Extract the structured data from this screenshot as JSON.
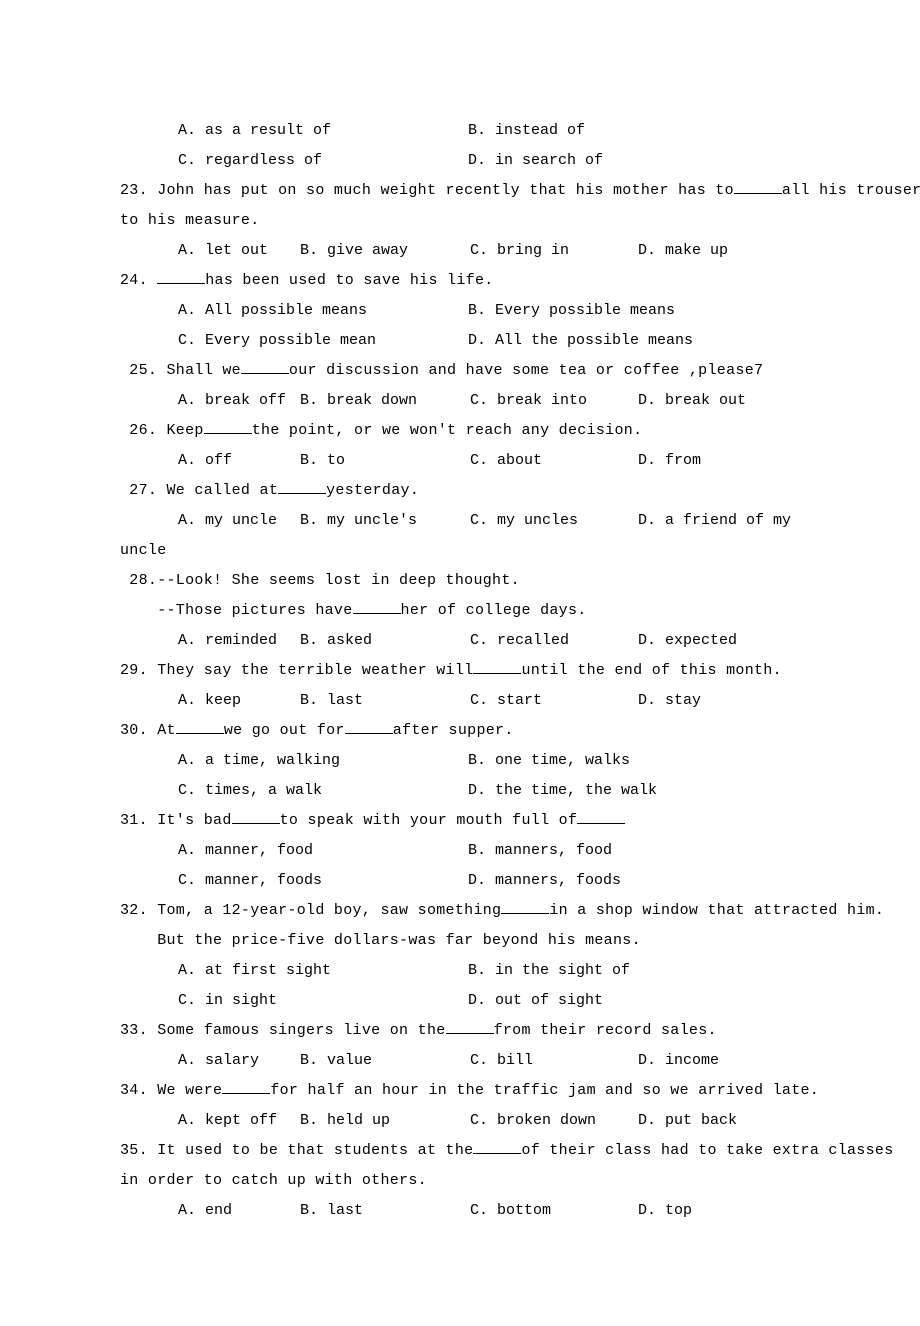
{
  "q22opts1": {
    "a": "A. as a result of",
    "b": "B. instead of"
  },
  "q22opts2": {
    "c": "C. regardless of",
    "d": "D. in search of"
  },
  "q23": {
    "stem_a": "23. John has put on so much weight recently that his mother has to",
    "stem_b": "all his trousers",
    "stem_c": "to his measure.",
    "a": "A. let out",
    "b": "B. give away",
    "c": "C. bring in",
    "d": "D. make up"
  },
  "q24": {
    "stem_a": "24. ",
    "stem_b": "has been used to save his life.",
    "a": "A. All possible means",
    "b": "B. Every possible means",
    "c": "C. Every possible mean",
    "d": "D. All the possible means"
  },
  "q25": {
    "stem_a": " 25. Shall we",
    "stem_b": "our discussion and have some tea or coffee ,please7",
    "a": "A. break off",
    "b": "B. break down",
    "c": "C. break into",
    "d": "D. break out"
  },
  "q26": {
    "stem_a": " 26. Keep",
    "stem_b": "the point, or we won't reach any decision.",
    "a": "A. off",
    "b": "B. to",
    "c": "C. about",
    "d": "D. from"
  },
  "q27": {
    "stem_a": " 27. We called at",
    "stem_b": "yesterday.",
    "a": "A. my uncle",
    "b": "B. my uncle's",
    "c": "C. my uncles",
    "d": "D.  a friend of my",
    "tail": "uncle"
  },
  "q28": {
    "stem1": " 28.--Look! She seems lost in deep thought.",
    "stem2a": "    --Those pictures have",
    "stem2b": "her of college days.",
    "a": "A. reminded",
    "b": "B. asked",
    "c": "C. recalled",
    "d": "D. expected"
  },
  "q29": {
    "stem_a": "29. They say the terrible weather will",
    "stem_b": "until the end of this month.",
    "a": "A. keep",
    "b": "B. last",
    "c": "C. start",
    "d": "D. stay"
  },
  "q30": {
    "stem_a": "30. At",
    "stem_b": "we go out for",
    "stem_c": "after supper.",
    "a": "A. a time, walking",
    "b": "B. one time, walks",
    "c": "C. times, a walk",
    "d": "D. the time, the walk"
  },
  "q31": {
    "stem_a": "31. It's bad",
    "stem_b": "to speak with your mouth full of",
    "a": "A. manner, food",
    "b": "B. manners, food",
    "c": "C. manner, foods",
    "d": "D. manners, foods"
  },
  "q32": {
    "stem_a": "32. Tom, a 12-year-old boy, saw something",
    "stem_b": "in a shop window that attracted him.",
    "stem2": "    But the price-five dollars-was far beyond his means.",
    "a": "A. at first sight",
    "b": "B. in the sight of",
    "c": "C. in sight",
    "d": "D. out of sight"
  },
  "q33": {
    "stem_a": "33. Some famous singers live on the",
    "stem_b": "from their record sales.",
    "a": "A. salary",
    "b": "B. value",
    "c": "C. bill",
    "d": "D. income"
  },
  "q34": {
    "stem_a": "34. We were",
    "stem_b": "for half an hour in the traffic jam and so we arrived late.",
    "a": "A. kept off",
    "b": "B. held up",
    "c": "C. broken down",
    "d": "D. put back"
  },
  "q35": {
    "stem_a": "35. It used to be that students at the",
    "stem_b": "of their class had to take extra classes",
    "stem2": "in order to catch up with others.",
    "a": "A. end",
    "b": "B. last",
    "c": "C. bottom",
    "d": "D. top"
  }
}
